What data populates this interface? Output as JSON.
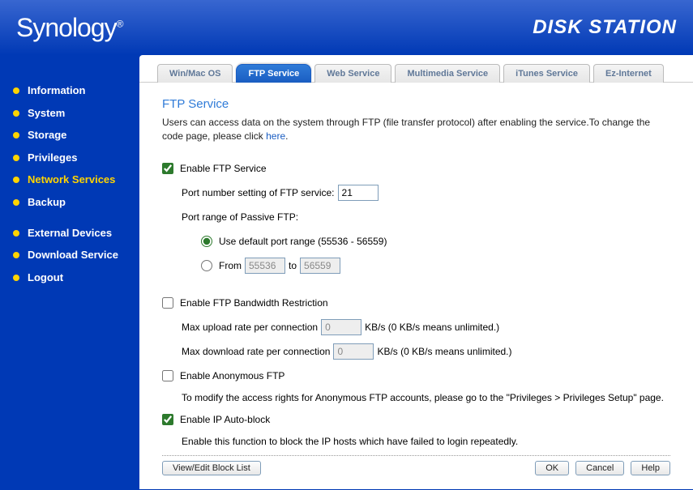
{
  "header": {
    "logo": "Synology",
    "product_title": "DISK STATION"
  },
  "sidebar": {
    "items": [
      {
        "label": "Information"
      },
      {
        "label": "System"
      },
      {
        "label": "Storage"
      },
      {
        "label": "Privileges"
      },
      {
        "label": "Network Services"
      },
      {
        "label": "Backup"
      },
      {
        "label": "External Devices"
      },
      {
        "label": "Download Service"
      },
      {
        "label": "Logout"
      }
    ],
    "active_index": 4
  },
  "tabs": {
    "items": [
      {
        "label": "Win/Mac OS"
      },
      {
        "label": "FTP Service"
      },
      {
        "label": "Web Service"
      },
      {
        "label": "Multimedia Service"
      },
      {
        "label": "iTunes Service"
      },
      {
        "label": "Ez-Internet"
      }
    ],
    "active_index": 1
  },
  "page": {
    "title": "FTP Service",
    "desc_prefix": "Users can access data on the system through FTP (file transfer protocol) after enabling the service.To change the code page, please click ",
    "desc_link": "here",
    "desc_suffix": ".",
    "enable_ftp": {
      "label": "Enable FTP Service",
      "checked": true
    },
    "port_row": {
      "label": "Port number setting of FTP service:",
      "value": "21"
    },
    "passive_label": "Port range of Passive FTP:",
    "passive_default": {
      "label": "Use default port range (55536 - 56559)",
      "selected": true
    },
    "passive_custom": {
      "label_from": "From",
      "label_to": "to",
      "value_from": "55536",
      "value_to": "56559",
      "selected": false
    },
    "bandwidth": {
      "label": "Enable FTP Bandwidth Restriction",
      "checked": false,
      "upload_label": "Max upload rate per connection",
      "download_label": "Max download rate per connection",
      "upload_value": "0",
      "download_value": "0",
      "unit_note": "KB/s (0 KB/s means unlimited.)"
    },
    "anonymous": {
      "label": "Enable Anonymous FTP",
      "checked": false,
      "note": "To modify the access rights for Anonymous FTP accounts, please go to the \"Privileges > Privileges Setup\" page."
    },
    "autoblock": {
      "label": "Enable IP Auto-block",
      "checked": true,
      "note": "Enable this function to block the IP hosts which have failed to login repeatedly."
    },
    "buttons": {
      "blocklist": "View/Edit Block List",
      "ok": "OK",
      "cancel": "Cancel",
      "help": "Help"
    }
  }
}
